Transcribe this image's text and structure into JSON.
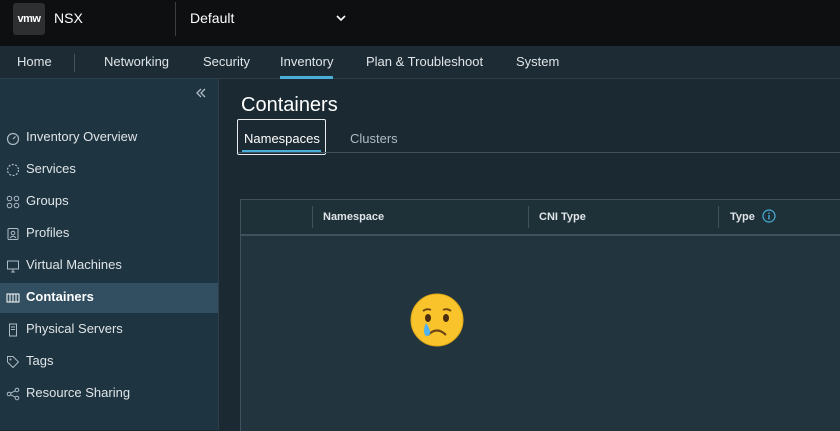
{
  "header": {
    "logo_text": "vmw",
    "app_name": "NSX",
    "project_selector": "Default"
  },
  "nav": {
    "tabs": [
      {
        "label": "Home"
      },
      {
        "label": "Networking"
      },
      {
        "label": "Security"
      },
      {
        "label": "Inventory",
        "active": true
      },
      {
        "label": "Plan & Troubleshoot"
      },
      {
        "label": "System"
      }
    ]
  },
  "sidebar": {
    "items": [
      {
        "label": "Inventory Overview",
        "icon": "dashboard-icon"
      },
      {
        "label": "Services",
        "icon": "services-icon"
      },
      {
        "label": "Groups",
        "icon": "groups-icon"
      },
      {
        "label": "Profiles",
        "icon": "profiles-icon"
      },
      {
        "label": "Virtual Machines",
        "icon": "vm-icon"
      },
      {
        "label": "Containers",
        "icon": "containers-icon",
        "active": true
      },
      {
        "label": "Physical Servers",
        "icon": "server-icon"
      },
      {
        "label": "Tags",
        "icon": "tag-icon"
      },
      {
        "label": "Resource Sharing",
        "icon": "share-icon"
      }
    ]
  },
  "main": {
    "title": "Containers",
    "tabs": [
      {
        "label": "Namespaces",
        "active": true
      },
      {
        "label": "Clusters"
      }
    ],
    "table": {
      "columns": [
        "Namespace",
        "CNI Type",
        "Type"
      ]
    },
    "empty_state_icon": "crying-face-icon"
  },
  "colors": {
    "accent": "#49afd9",
    "header_bg": "#0d0f11",
    "sidebar_bg": "#1f3441",
    "sidebar_active": "#324f61"
  }
}
